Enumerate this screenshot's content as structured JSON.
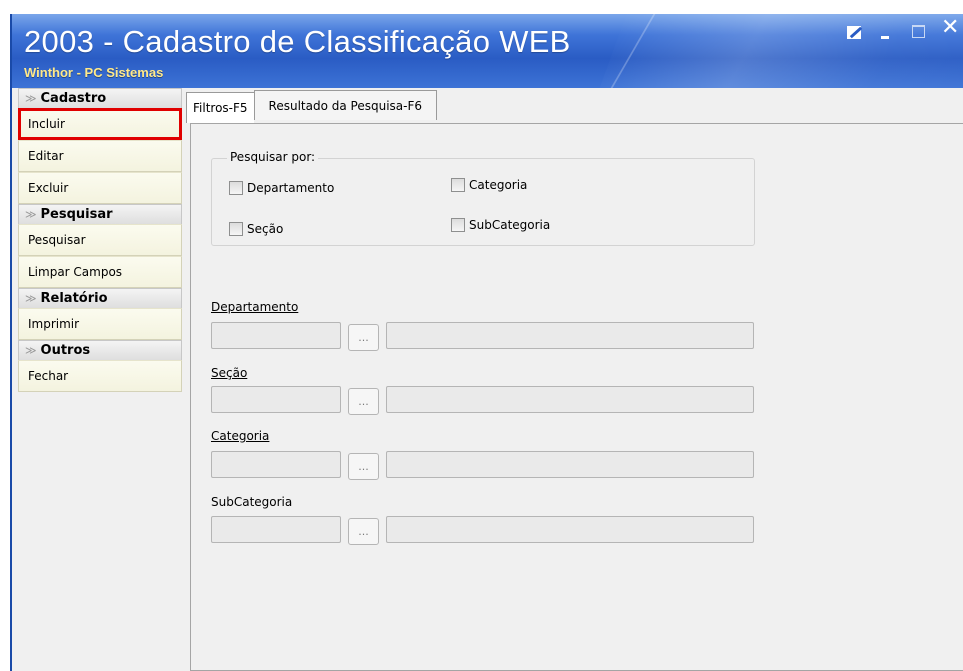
{
  "window": {
    "title": "2003 - Cadastro de Classificação WEB",
    "subtitle": "Winthor - PC Sistemas"
  },
  "sidebar": {
    "groups": [
      {
        "label": "Cadastro",
        "items": [
          {
            "label": "Incluir",
            "highlighted": true
          },
          {
            "label": "Editar"
          },
          {
            "label": "Excluir"
          }
        ]
      },
      {
        "label": "Pesquisar",
        "items": [
          {
            "label": "Pesquisar"
          },
          {
            "label": "Limpar Campos"
          }
        ]
      },
      {
        "label": "Relatório",
        "items": [
          {
            "label": "Imprimir"
          }
        ]
      },
      {
        "label": "Outros",
        "items": [
          {
            "label": "Fechar"
          }
        ]
      }
    ]
  },
  "tabs": [
    {
      "label": "Filtros-F5",
      "active": true
    },
    {
      "label": "Resultado da Pesquisa-F6",
      "active": false
    }
  ],
  "filters": {
    "search_by_label": "Pesquisar por:",
    "checkboxes": [
      {
        "label": "Departamento",
        "checked": false
      },
      {
        "label": "Categoria",
        "checked": false
      },
      {
        "label": "Seção",
        "checked": false
      },
      {
        "label": "SubCategoria",
        "checked": false
      }
    ],
    "fields": [
      {
        "label": "Departamento",
        "code": "",
        "description": ""
      },
      {
        "label": "Seção",
        "code": "",
        "description": ""
      },
      {
        "label": "Categoria",
        "code": "",
        "description": ""
      },
      {
        "label": "SubCategoria",
        "code": "",
        "description": ""
      }
    ],
    "lookup_button_label": "..."
  },
  "colors": {
    "titlebar": "#2a5cc4",
    "subtitle": "#ffe98a",
    "highlight": "#e00000"
  }
}
